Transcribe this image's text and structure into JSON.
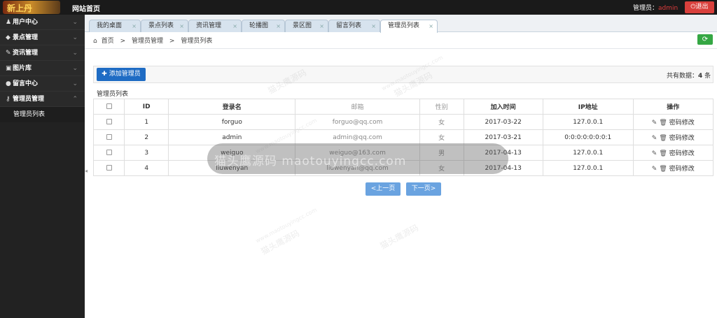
{
  "header": {
    "logo_text": "新上丹",
    "site_title": "网站首页",
    "admin_prefix": "管理员：",
    "admin_name": "admin",
    "logout_label": "退出"
  },
  "sidebar": {
    "items": [
      {
        "label": "用户中心",
        "icon": "user-icon"
      },
      {
        "label": "景点管理",
        "icon": "map-marker-icon"
      },
      {
        "label": "资讯管理",
        "icon": "edit-icon"
      },
      {
        "label": "图片库",
        "icon": "picture-icon"
      },
      {
        "label": "留言中心",
        "icon": "comment-icon"
      },
      {
        "label": "管理员管理",
        "icon": "key-icon"
      }
    ],
    "sub_items": [
      {
        "label": "管理员列表"
      }
    ]
  },
  "tabs": [
    {
      "label": "我的桌面"
    },
    {
      "label": "景点列表"
    },
    {
      "label": "资讯管理"
    },
    {
      "label": "轮播图"
    },
    {
      "label": "景区图"
    },
    {
      "label": "留言列表"
    },
    {
      "label": "管理员列表"
    }
  ],
  "breadcrumb": {
    "home": "首页",
    "sep": ">",
    "level1": "管理员管理",
    "level2": "管理员列表"
  },
  "toolbar": {
    "add_label": "添加管理员",
    "total_prefix": "共有数据：",
    "total_count": "4",
    "total_suffix": "条"
  },
  "list_title": "管理员列表",
  "table": {
    "headers": [
      "ID",
      "登录名",
      "邮箱",
      "性别",
      "加入时间",
      "IP地址",
      "操作"
    ],
    "rows": [
      {
        "id": "1",
        "login": "forguo",
        "email": "forguo@qq.com",
        "gender": "女",
        "joined": "2017-03-22",
        "ip": "127.0.0.1",
        "op": "密码修改"
      },
      {
        "id": "2",
        "login": "admin",
        "email": "admin@qq.com",
        "gender": "女",
        "joined": "2017-03-21",
        "ip": "0:0:0:0:0:0:0:1",
        "op": "密码修改"
      },
      {
        "id": "3",
        "login": "weiguo",
        "email": "weiguo@163.com",
        "gender": "男",
        "joined": "2017-04-13",
        "ip": "127.0.0.1",
        "op": "密码修改"
      },
      {
        "id": "4",
        "login": "liuwenyan",
        "email": "liuwenyan@qq.com",
        "gender": "女",
        "joined": "2017-04-13",
        "ip": "127.0.0.1",
        "op": "密码修改"
      }
    ]
  },
  "pager": {
    "prev": "<上一页",
    "next": "下一页>"
  },
  "watermark": {
    "text": "猫头鹰源码",
    "url": "www.maotouyingcc.com",
    "band": "猫头鹰源码 maotouyingcc.com"
  }
}
